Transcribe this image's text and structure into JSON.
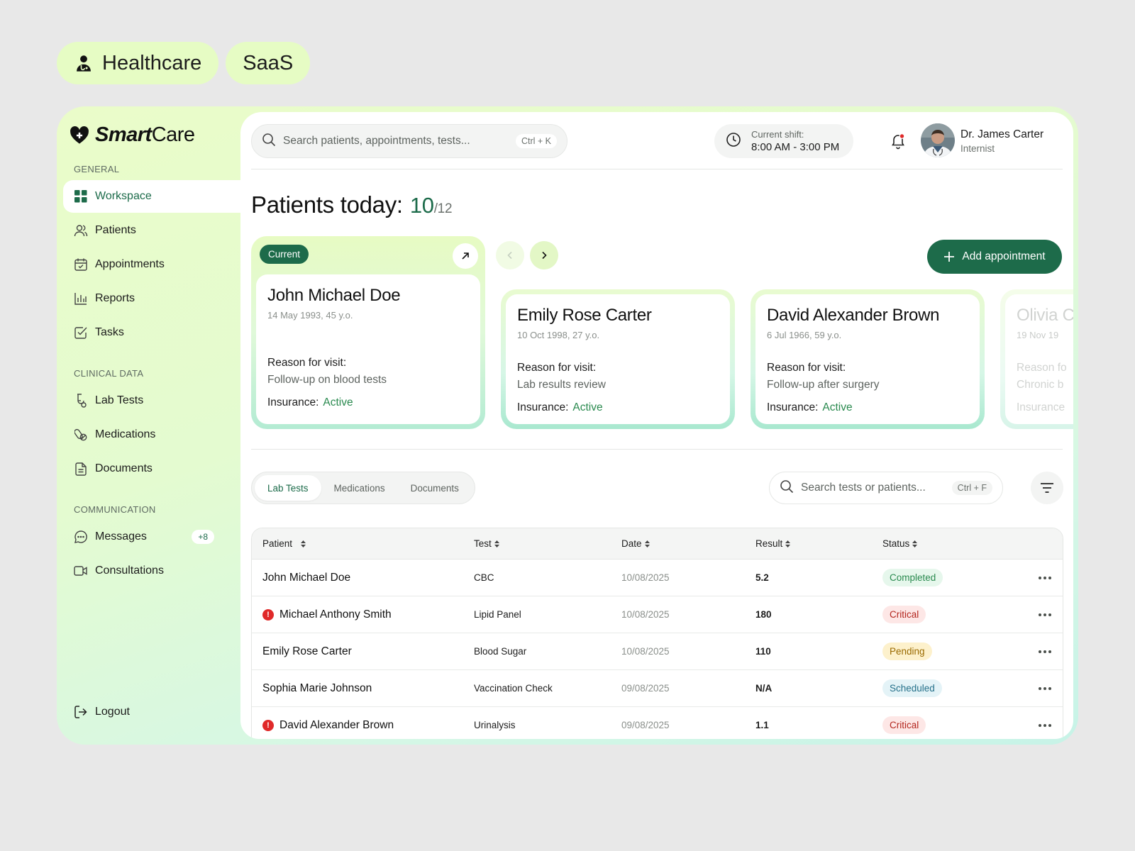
{
  "tags": [
    "Healthcare",
    "SaaS"
  ],
  "app": {
    "brand_bold": "Smart",
    "brand_light": "Care"
  },
  "sidebar": {
    "sections": [
      "GENERAL",
      "CLINICAL DATA",
      "COMMUNICATION"
    ],
    "items": [
      {
        "label": "Workspace",
        "icon": "grid-icon"
      },
      {
        "label": "Patients",
        "icon": "users-icon"
      },
      {
        "label": "Appointments",
        "icon": "calendar-icon"
      },
      {
        "label": "Reports",
        "icon": "bar-chart-icon"
      },
      {
        "label": "Tasks",
        "icon": "checkbox-icon"
      },
      {
        "label": "Lab Tests",
        "icon": "flask-icon"
      },
      {
        "label": "Medications",
        "icon": "pills-icon"
      },
      {
        "label": "Documents",
        "icon": "document-icon"
      },
      {
        "label": "Messages",
        "icon": "chat-icon",
        "badge": "+8"
      },
      {
        "label": "Consultations",
        "icon": "video-icon"
      }
    ],
    "logout": "Logout"
  },
  "header": {
    "search_placeholder": "Search patients, appointments, tests...",
    "search_shortcut": "Ctrl + K",
    "shift_label": "Current shift:",
    "shift_value": "8:00 AM - 3:00 PM",
    "doctor_name": "Dr. James Carter",
    "doctor_role": "Internist"
  },
  "patients_today": {
    "title": "Patients today:",
    "count": "10",
    "total": "/12"
  },
  "cards": [
    {
      "badge": "Current",
      "name": "John Michael Doe",
      "dob": "14 May 1993, 45 y.o.",
      "reason_label": "Reason for visit:",
      "reason": "Follow-up on blood tests",
      "insurance_label": "Insurance:",
      "insurance": "Active"
    },
    {
      "name": "Emily Rose Carter",
      "dob": "10 Oct 1998, 27 y.o.",
      "reason_label": "Reason for visit:",
      "reason": "Lab results review",
      "insurance_label": "Insurance:",
      "insurance": "Active"
    },
    {
      "name": "David Alexander Brown",
      "dob": "6 Jul 1966, 59 y.o.",
      "reason_label": "Reason for visit:",
      "reason": "Follow-up after surgery",
      "insurance_label": "Insurance:",
      "insurance": "Active"
    },
    {
      "name": "Olivia C",
      "dob": "19 Nov 19",
      "reason_label": "Reason fo",
      "reason": "Chronic b",
      "insurance_label": "Insurance"
    }
  ],
  "add_appointment": "Add appointment",
  "tabs": [
    "Lab Tests",
    "Medications",
    "Documents"
  ],
  "table_search": {
    "placeholder": "Search tests or patients...",
    "shortcut": "Ctrl + F"
  },
  "table": {
    "headers": [
      "Patient",
      "Test",
      "Date",
      "Result",
      "Status"
    ],
    "rows": [
      {
        "patient": "John Michael Doe",
        "alert": false,
        "test": "CBC",
        "date": "10/08/2025",
        "result": "5.2",
        "status": "Completed",
        "status_color": "#2a8a4f",
        "status_bg": "#e6f7ec"
      },
      {
        "patient": "Michael Anthony Smith",
        "alert": true,
        "test": "Lipid Panel",
        "date": "10/08/2025",
        "result": "180",
        "status": "Critical",
        "status_color": "#b3261e",
        "status_bg": "#fde7e6"
      },
      {
        "patient": "Emily Rose Carter",
        "alert": false,
        "test": "Blood Sugar",
        "date": "10/08/2025",
        "result": "110",
        "status": "Pending",
        "status_color": "#9a6a00",
        "status_bg": "#fdf1cc"
      },
      {
        "patient": "Sophia Marie Johnson",
        "alert": false,
        "test": "Vaccination Check",
        "date": "09/08/2025",
        "result": "N/A",
        "status": "Scheduled",
        "status_color": "#25708a",
        "status_bg": "#e4f3f7"
      },
      {
        "patient": "David Alexander Brown",
        "alert": true,
        "test": "Urinalysis",
        "date": "09/08/2025",
        "result": "1.1",
        "status": "Critical",
        "status_color": "#b3261e",
        "status_bg": "#fde7e6"
      }
    ]
  },
  "colors": {
    "accent": "#1d6b4a",
    "active_green": "#2a8a4f",
    "sidebar_bg": "#e6fcc4"
  }
}
